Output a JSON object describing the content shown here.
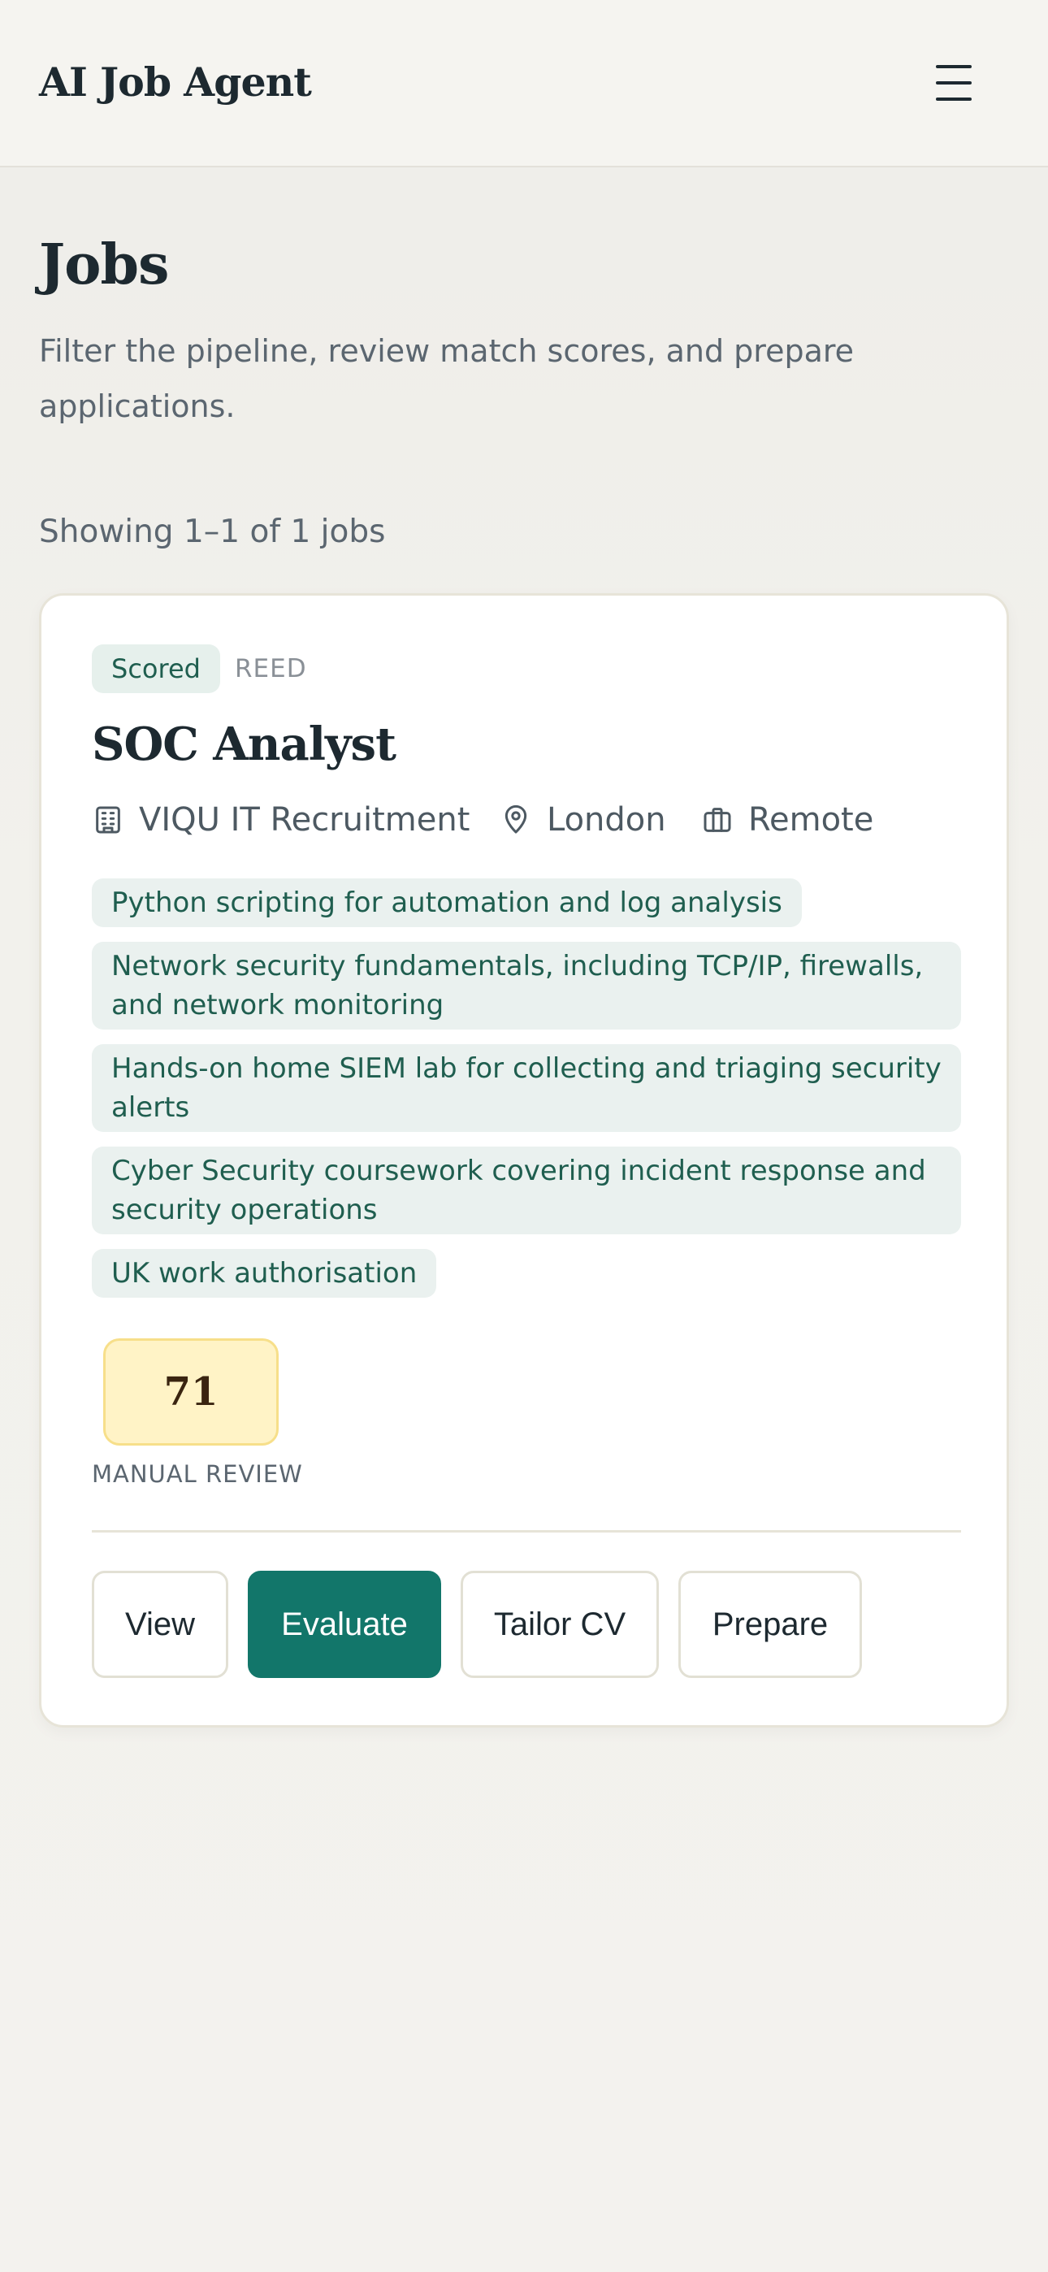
{
  "app": {
    "title": "AI Job Agent",
    "menu_icon": "hamburger-menu-icon"
  },
  "page": {
    "title": "Jobs",
    "subtitle": "Filter the pipeline, review match scores, and prepare applications.",
    "results_summary": "Showing 1–1 of 1 jobs"
  },
  "job": {
    "status": "Scored",
    "source": "REED",
    "title": "SOC Analyst",
    "company": "VIQU IT Recruitment",
    "company_icon": "building-icon",
    "location": "London",
    "location_icon": "map-pin-icon",
    "work_mode": "Remote",
    "work_mode_icon": "briefcase-icon",
    "tags": [
      "Python scripting for automation and log analysis",
      "Network security fundamentals, including TCP/IP, firewalls, and network monitoring",
      "Hands-on home SIEM lab for collecting and triaging security alerts",
      "Cyber Security coursework covering incident response and security operations",
      "UK work authorisation"
    ],
    "score": "71",
    "score_label": "MANUAL REVIEW",
    "actions": {
      "view": "View",
      "evaluate": "Evaluate",
      "tailor_cv": "Tailor CV",
      "prepare": "Prepare"
    }
  },
  "colors": {
    "primary": "#12766a",
    "score_background": "#fff3c6",
    "tag_background": "#eaf1ef",
    "tag_text": "#1f5e4f"
  }
}
